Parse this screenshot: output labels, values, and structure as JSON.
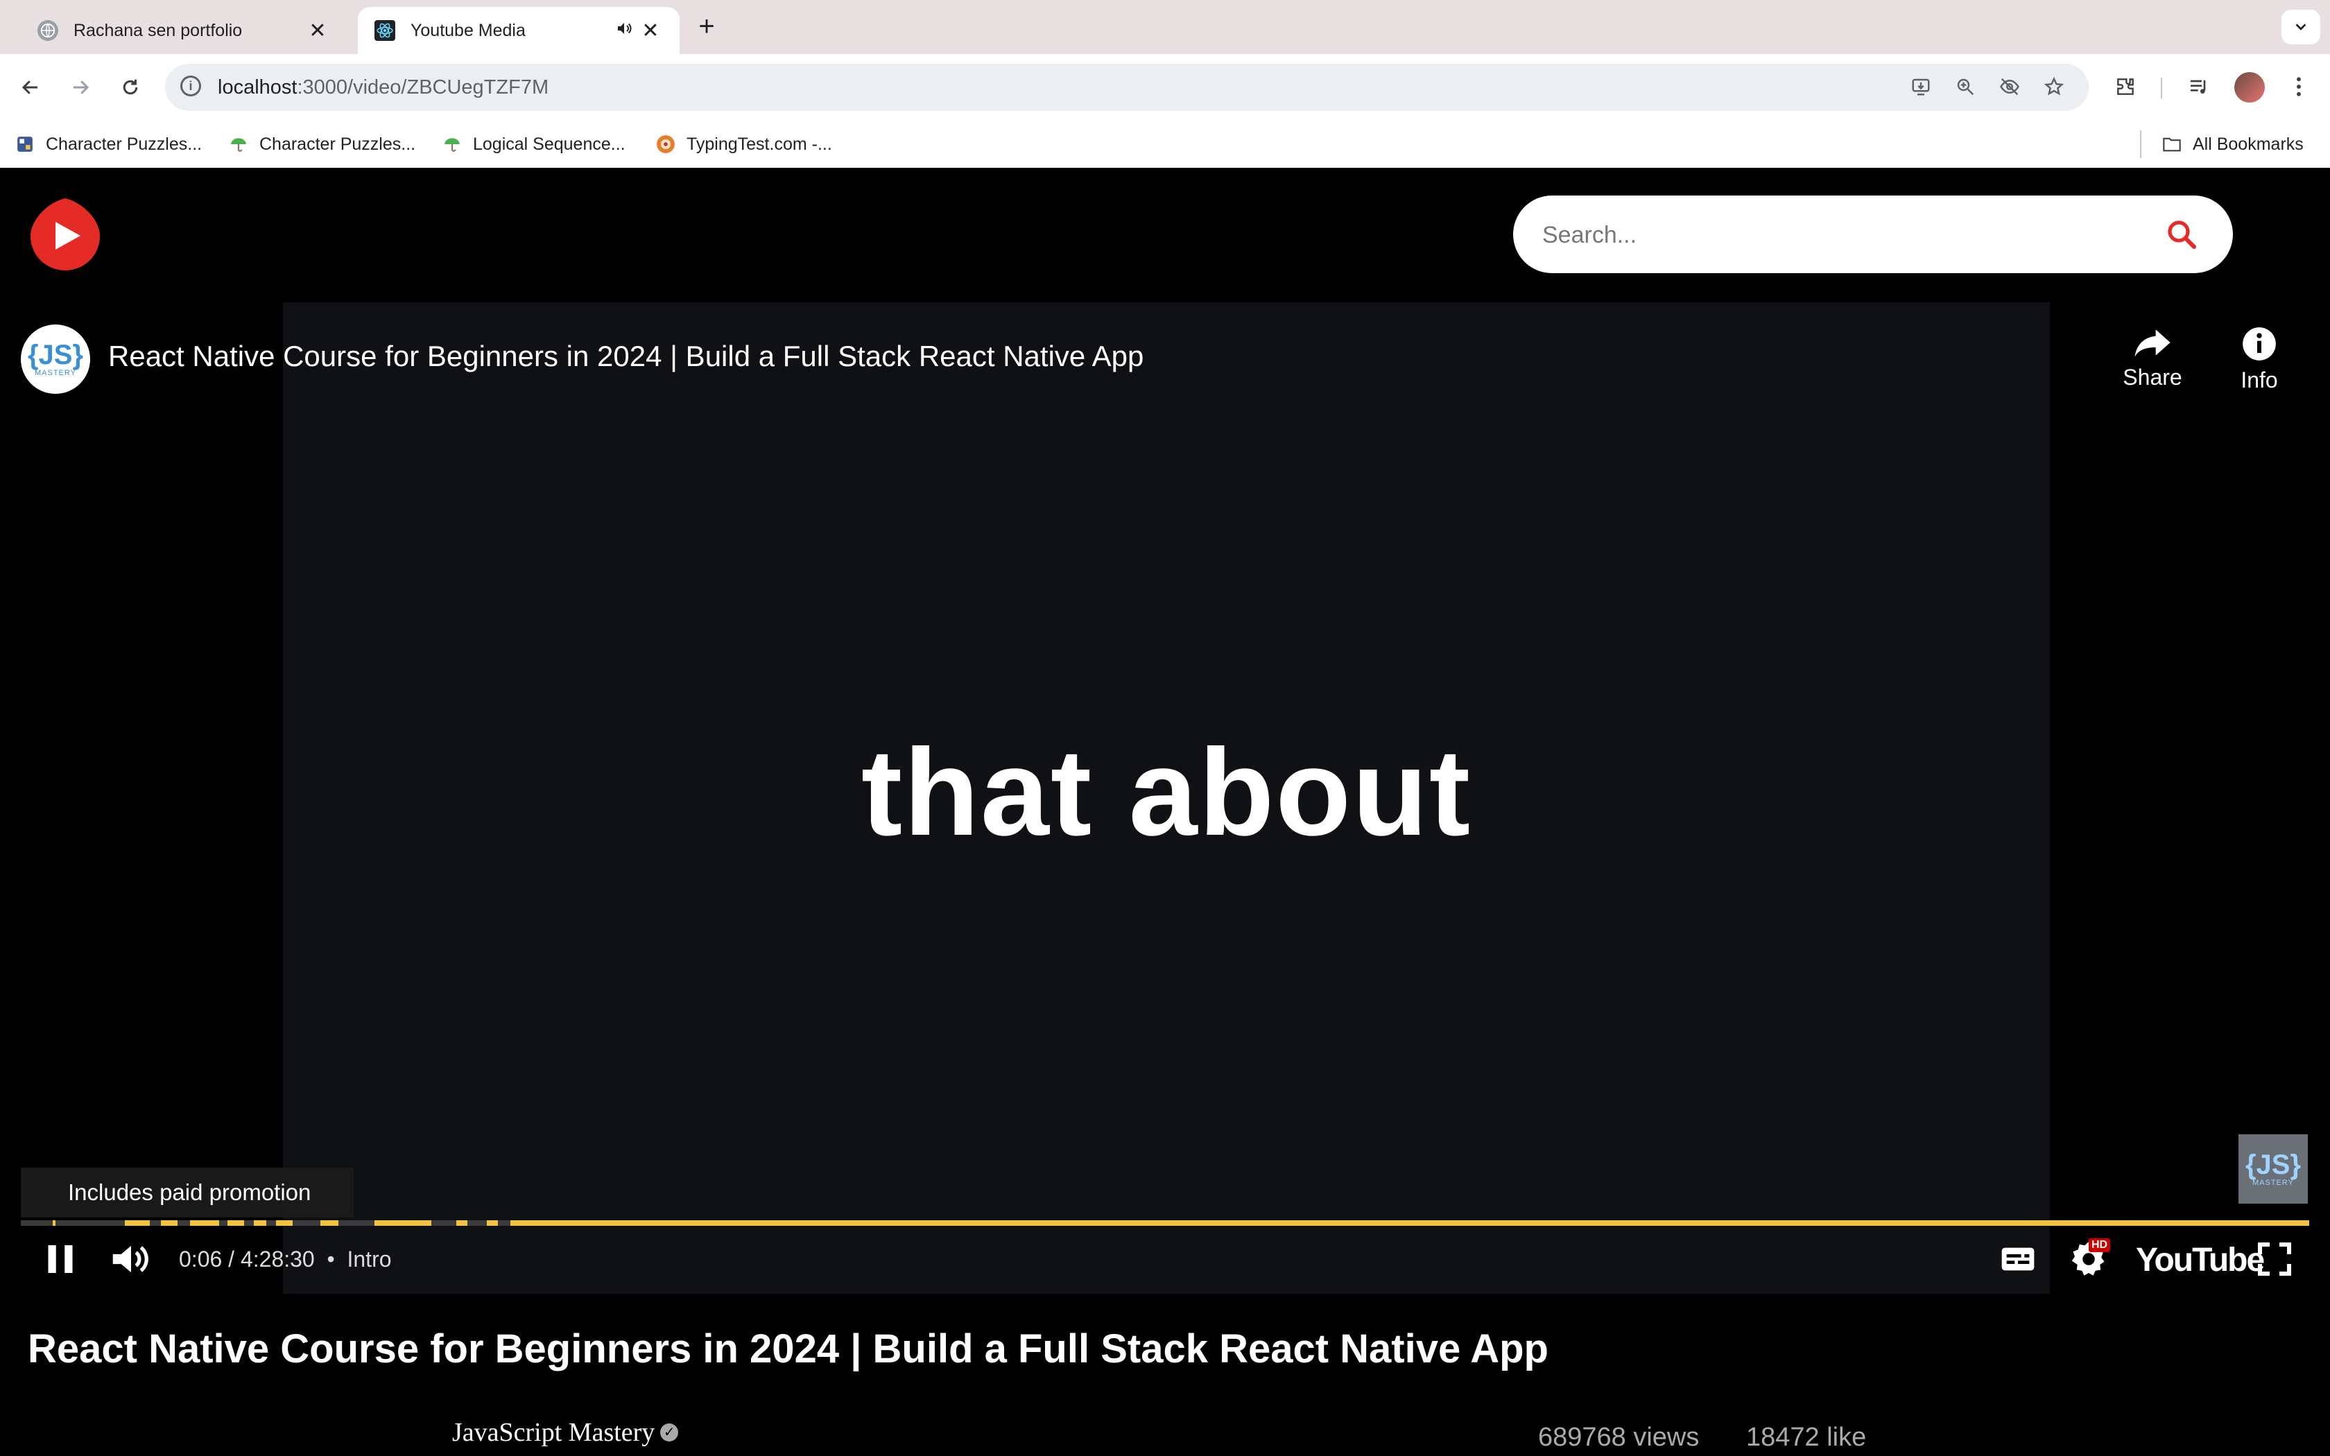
{
  "browser": {
    "tabs": [
      {
        "title": "Rachana sen portfolio",
        "active": false,
        "icon": "globe-icon"
      },
      {
        "title": "Youtube Media",
        "active": true,
        "icon": "react-icon",
        "audio": "speaker-icon"
      }
    ],
    "url_host": "localhost",
    "url_path": ":3000/video/ZBCUegTZF7M",
    "bookmarks": [
      {
        "label": "Character Puzzles...",
        "icon": "puzzle-icon"
      },
      {
        "label": "Character Puzzles...",
        "icon": "umbrella-icon"
      },
      {
        "label": "Logical Sequence...",
        "icon": "umbrella-icon"
      },
      {
        "label": "TypingTest.com -...",
        "icon": "typing-icon"
      }
    ],
    "all_bookmarks": "All Bookmarks"
  },
  "site": {
    "search_placeholder": "Search...",
    "accent": "#e42b26"
  },
  "player": {
    "video_title": "React Native Course for Beginners in 2024 | Build a Full Stack React Native App",
    "caption": "that about",
    "share_label": "Share",
    "info_label": "Info",
    "promo": "Includes paid promotion",
    "time_current": "0:06",
    "time_total": "4:28:30",
    "chapter": "Intro",
    "youtube_label": "YouTube",
    "hd_badge": "HD",
    "progress_fraction": 0.0004,
    "progress_color": "#f2c343"
  },
  "details": {
    "title": "React Native Course for Beginners in 2024 | Build a Full Stack React Native App",
    "channel": "JavaScript Mastery",
    "views": "689768 views",
    "likes": "18472 like"
  },
  "channel_logo": {
    "text": "{JS}",
    "sub": "MASTERY"
  }
}
